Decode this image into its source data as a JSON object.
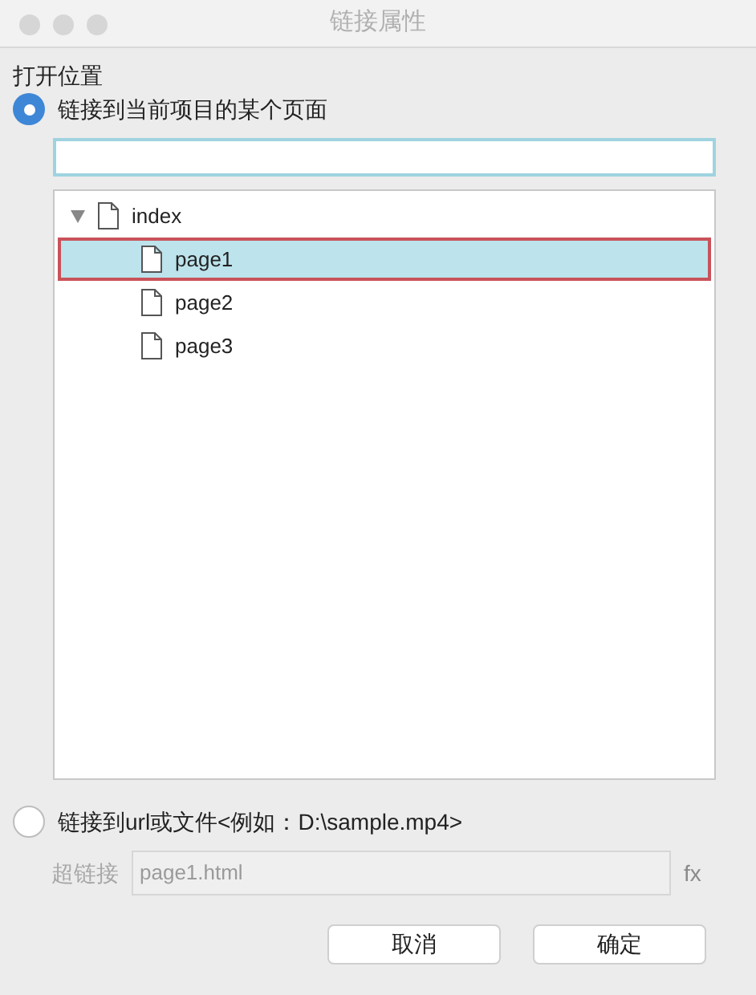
{
  "window": {
    "title": "链接属性"
  },
  "section_label": "打开位置",
  "options": [
    {
      "label": "链接到当前项目的某个页面",
      "selected": true
    },
    {
      "label": "链接到url或文件<例如：D:\\sample.mp4>",
      "selected": false
    }
  ],
  "tree": [
    {
      "label": "index",
      "expanded": true,
      "selected": false,
      "children": [
        {
          "label": "page1",
          "selected": true
        },
        {
          "label": "page2",
          "selected": false
        },
        {
          "label": "page3",
          "selected": false
        }
      ]
    }
  ],
  "hyperlink": {
    "label": "超链接",
    "value": "page1.html",
    "disabled": true,
    "suffix": "fx"
  },
  "buttons": [
    "取消",
    "确定"
  ]
}
